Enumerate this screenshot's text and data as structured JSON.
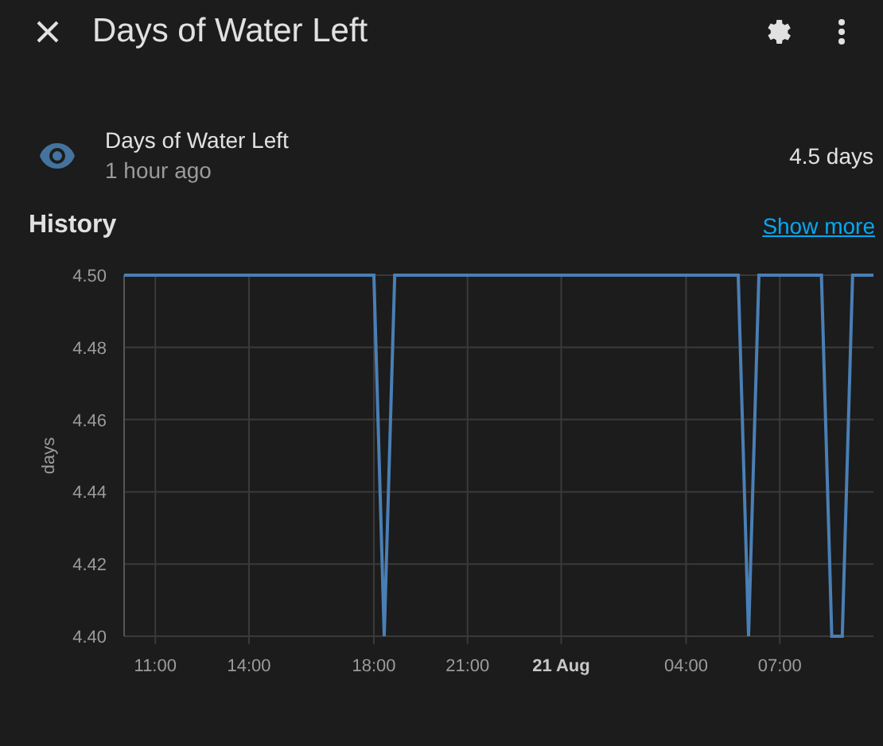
{
  "dialog": {
    "title": "Days of Water Left"
  },
  "entity": {
    "name": "Days of Water Left",
    "updated": "1 hour ago",
    "state": "4.5 days"
  },
  "history": {
    "title": "History",
    "link": "Show more",
    "chart_data": {
      "type": "line",
      "ylabel": "days",
      "grid": true,
      "ylim": [
        4.4,
        4.5
      ],
      "yticks": [
        {
          "value": 4.4,
          "label": "4.40"
        },
        {
          "value": 4.42,
          "label": "4.42"
        },
        {
          "value": 4.44,
          "label": "4.44"
        },
        {
          "value": 4.46,
          "label": "4.46"
        },
        {
          "value": 4.48,
          "label": "4.48"
        },
        {
          "value": 4.5,
          "label": "4.50"
        }
      ],
      "categories": [
        null,
        null,
        null,
        "11:00",
        null,
        null,
        null,
        null,
        null,
        null,
        null,
        null,
        "14:00",
        null,
        null,
        null,
        null,
        null,
        null,
        null,
        null,
        null,
        null,
        null,
        "18:00",
        null,
        null,
        null,
        null,
        null,
        null,
        null,
        null,
        "21:00",
        null,
        null,
        null,
        null,
        null,
        null,
        null,
        null,
        "21 Aug",
        null,
        null,
        null,
        null,
        null,
        null,
        null,
        null,
        null,
        null,
        null,
        "04:00",
        null,
        null,
        null,
        null,
        null,
        null,
        null,
        null,
        "07:00",
        null,
        null,
        null,
        null,
        null,
        null,
        null,
        null,
        null
      ],
      "series": [
        {
          "color": "#4a7fb5",
          "values": [
            4.5,
            4.5,
            4.5,
            4.5,
            4.5,
            4.5,
            4.5,
            4.5,
            4.5,
            4.5,
            4.5,
            4.5,
            4.5,
            4.5,
            4.5,
            4.5,
            4.5,
            4.5,
            4.5,
            4.5,
            4.5,
            4.5,
            4.5,
            4.5,
            4.5,
            4.4,
            4.5,
            4.5,
            4.5,
            4.5,
            4.5,
            4.5,
            4.5,
            4.5,
            4.5,
            4.5,
            4.5,
            4.5,
            4.5,
            4.5,
            4.5,
            4.5,
            4.5,
            4.5,
            4.5,
            4.5,
            4.5,
            4.5,
            4.5,
            4.5,
            4.5,
            4.5,
            4.5,
            4.5,
            4.5,
            4.5,
            4.5,
            4.5,
            4.5,
            4.5,
            4.4,
            4.5,
            4.5,
            4.5,
            4.5,
            4.5,
            4.5,
            4.5,
            4.4,
            4.4,
            4.5,
            4.5,
            4.5
          ]
        }
      ]
    }
  }
}
